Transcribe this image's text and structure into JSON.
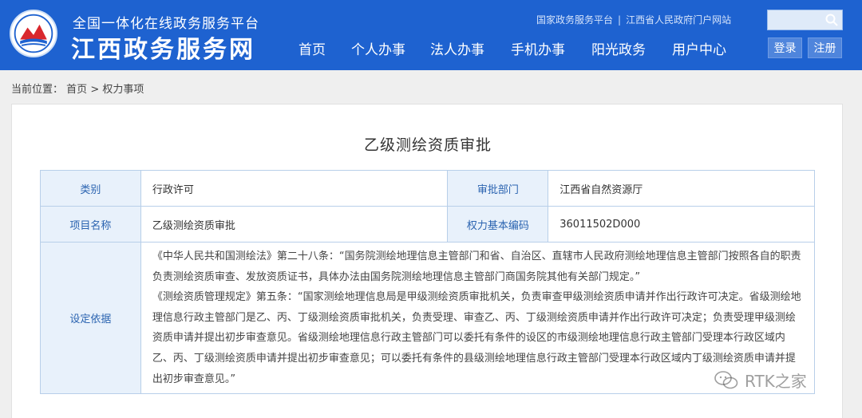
{
  "header": {
    "subtitle": "全国一体化在线政务服务平台",
    "title": "江西政务服务网",
    "toplinks": [
      "国家政务服务平台",
      "江西省人民政府门户网站"
    ],
    "toplink_separator": "|",
    "search_placeholder": "",
    "nav": [
      "首页",
      "个人办事",
      "法人办事",
      "手机办事",
      "阳光政务",
      "用户中心"
    ],
    "login_label": "登录",
    "register_label": "注册",
    "brand_color": "#1e62d0"
  },
  "breadcrumb": {
    "prefix": "当前位置：",
    "home": "首页",
    "separator": ">",
    "current": "权力事项"
  },
  "main": {
    "title": "乙级测绘资质审批",
    "rows": {
      "category_label": "类别",
      "category_value": "行政许可",
      "dept_label": "审批部门",
      "dept_value": "江西省自然资源厅",
      "name_label": "项目名称",
      "name_value": "乙级测绘资质审批",
      "code_label": "权力基本编码",
      "code_value": "36011502D000",
      "basis_label": "设定依据",
      "basis_p1": "《中华人民共和国测绘法》第二十八条：“国务院测绘地理信息主管部门和省、自治区、直辖市人民政府测绘地理信息主管部门按照各自的职责负责测绘资质审查、发放资质证书，具体办法由国务院测绘地理信息主管部门商国务院其他有关部门规定。”",
      "basis_p2": "《测绘资质管理规定》第五条：“国家测绘地理信息局是甲级测绘资质审批机关，负责审查甲级测绘资质申请并作出行政许可决定。省级测绘地理信息行政主管部门是乙、丙、丁级测绘资质审批机关，负责受理、审查乙、丙、丁级测绘资质申请并作出行政许可决定；负责受理甲级测绘资质申请并提出初步审查意见。省级测绘地理信息行政主管部门可以委托有条件的设区的市级测绘地理信息行政主管部门受理本行政区域内乙、丙、丁级测绘资质申请并提出初步审查意见；可以委托有条件的县级测绘地理信息行政主管部门受理本行政区域内丁级测绘资质申请并提出初步审查意见。”"
    }
  },
  "watermark": {
    "text": "RTK之家"
  }
}
